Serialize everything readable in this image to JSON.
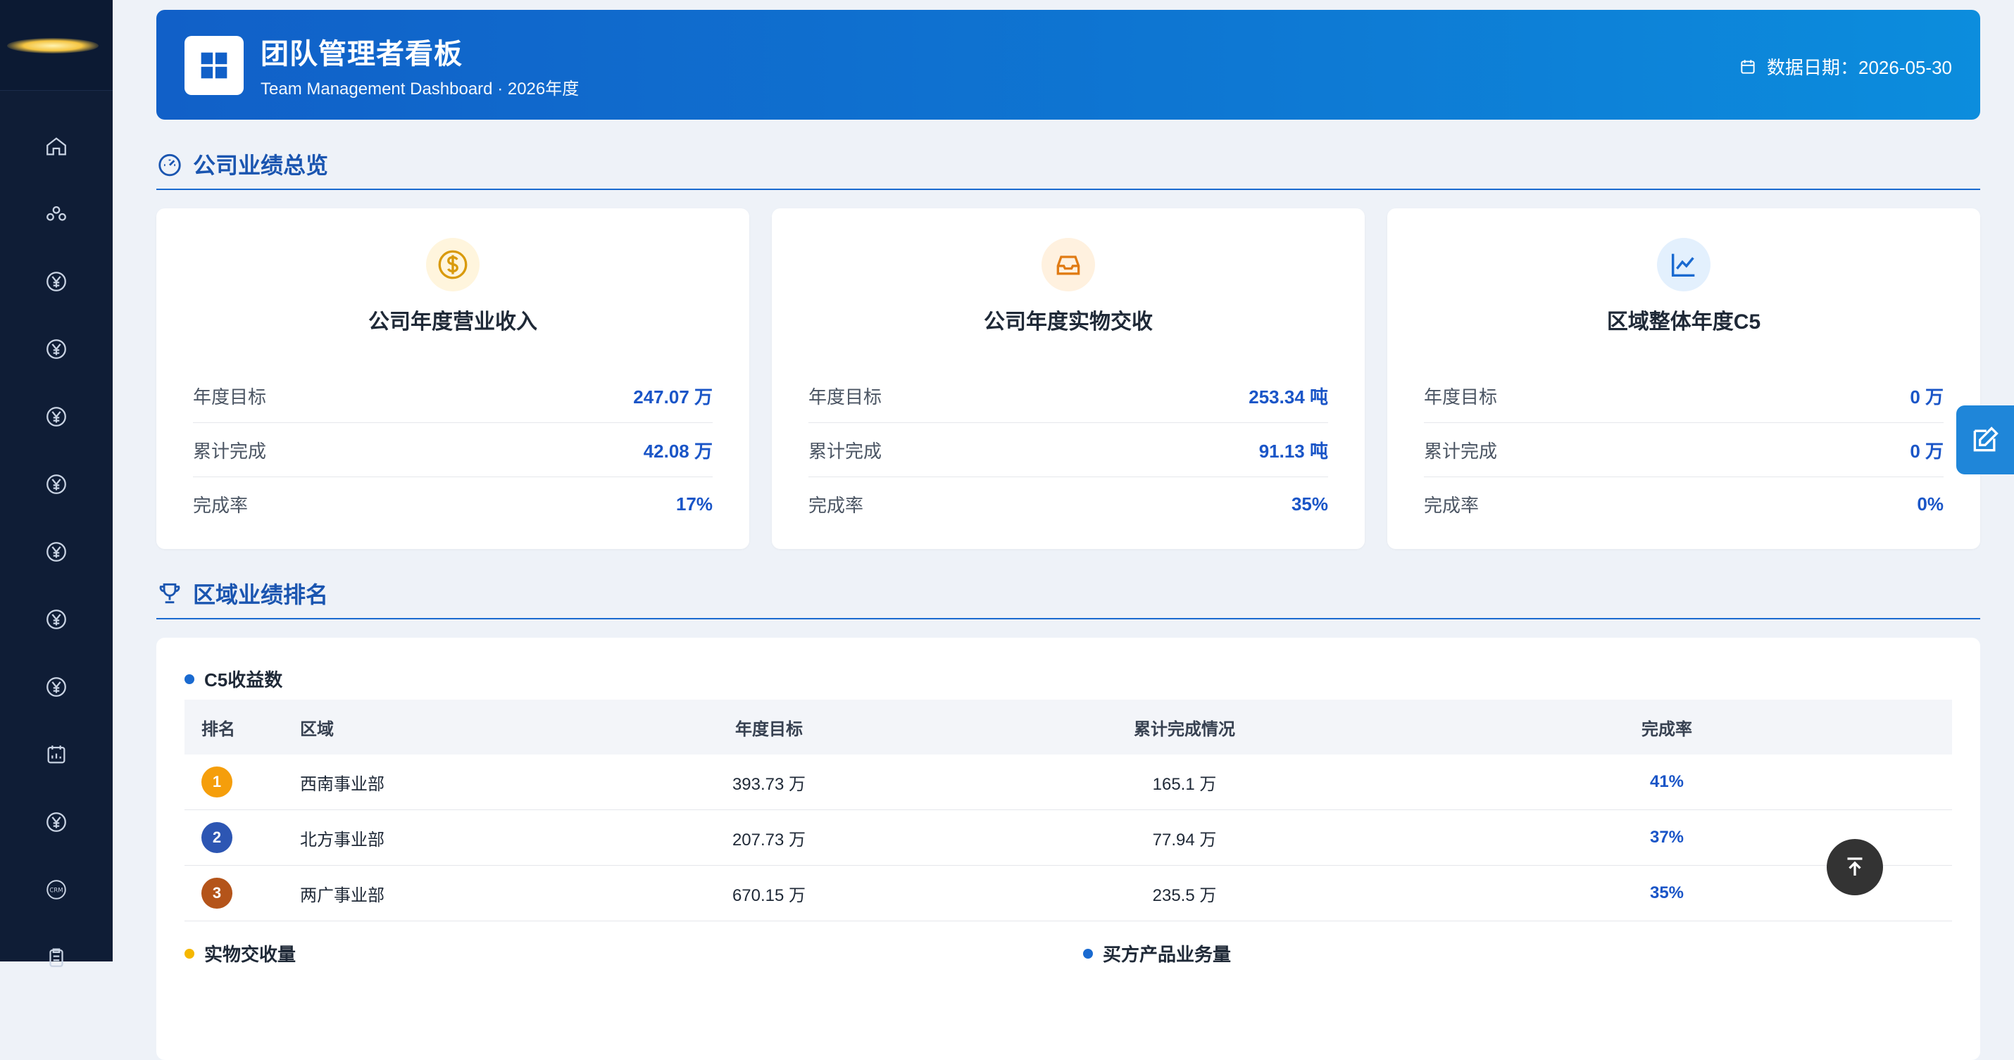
{
  "header": {
    "title": "团队管理者看板",
    "subtitle": "Team Management Dashboard · 2026年度",
    "date_label": "数据日期：2026-05-30"
  },
  "sidebar": {
    "items": [
      {
        "icon": "home-icon"
      },
      {
        "icon": "team-icon"
      },
      {
        "icon": "yen-icon"
      },
      {
        "icon": "yen-icon"
      },
      {
        "icon": "yen-icon"
      },
      {
        "icon": "yen-icon"
      },
      {
        "icon": "yen-icon"
      },
      {
        "icon": "yen-icon"
      },
      {
        "icon": "yen-icon"
      },
      {
        "icon": "calendar-chart-icon"
      },
      {
        "icon": "yen-icon"
      },
      {
        "icon": "crm-icon"
      },
      {
        "icon": "clipboard-icon"
      }
    ]
  },
  "overview": {
    "section_title": "公司业绩总览",
    "cards": [
      {
        "title": "公司年度营业收入",
        "icon": "dollar-icon",
        "rows": [
          {
            "label": "年度目标",
            "value": "247.07 万"
          },
          {
            "label": "累计完成",
            "value": "42.08 万"
          },
          {
            "label": "完成率",
            "value": "17%"
          }
        ]
      },
      {
        "title": "公司年度实物交收",
        "icon": "inbox-icon",
        "rows": [
          {
            "label": "年度目标",
            "value": "253.34 吨"
          },
          {
            "label": "累计完成",
            "value": "91.13 吨"
          },
          {
            "label": "完成率",
            "value": "35%"
          }
        ]
      },
      {
        "title": "区域整体年度C5",
        "icon": "trend-chart-icon",
        "rows": [
          {
            "label": "年度目标",
            "value": "0 万"
          },
          {
            "label": "累计完成",
            "value": "0 万"
          },
          {
            "label": "完成率",
            "value": "0%"
          }
        ]
      }
    ]
  },
  "ranking": {
    "section_title": "区域业绩排名",
    "panel_title": "C5收益数",
    "columns": [
      "排名",
      "区域",
      "年度目标",
      "累计完成情况",
      "完成率"
    ],
    "rows": [
      {
        "rank": "1",
        "region": "西南事业部",
        "target": "393.73 万",
        "done": "165.1 万",
        "rate": "41%",
        "badge_color": "#f59e0b"
      },
      {
        "rank": "2",
        "region": "北方事业部",
        "target": "207.73 万",
        "done": "77.94 万",
        "rate": "37%",
        "badge_color": "#2d56b3"
      },
      {
        "rank": "3",
        "region": "两广事业部",
        "target": "670.15 万",
        "done": "235.5 万",
        "rate": "35%",
        "badge_color": "#b4541a"
      }
    ],
    "next_left_title": "实物交收量",
    "next_right_title": "买方产品业务量"
  },
  "colors": {
    "accent": "#1a6ad0",
    "header_start": "#1160c8",
    "header_end": "#0c8ddd",
    "sidebar": "#0f1d36"
  }
}
